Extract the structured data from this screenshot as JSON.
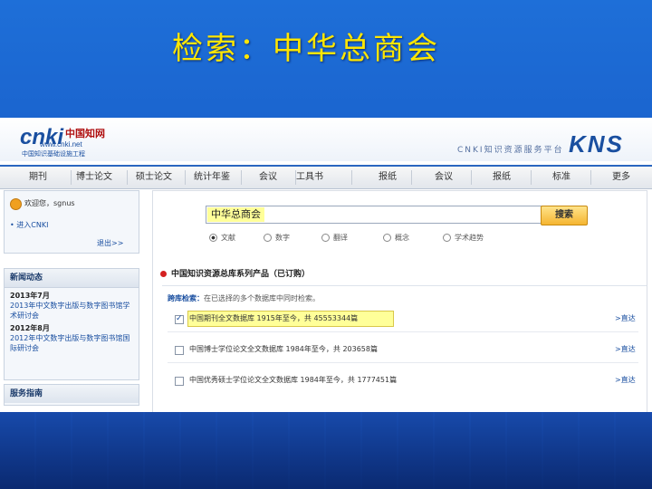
{
  "slide": {
    "title": "检索：中华总商会"
  },
  "header": {
    "logo_main": "cnki",
    "logo_cn": "中国知网",
    "logo_url": "www.cnki.net",
    "logo_sub": "中国知识基础设施工程",
    "tagline": "CNKI知识资源服务平台",
    "product": "KNS"
  },
  "nav": {
    "items": [
      "期刊",
      "博士论文",
      "硕士论文",
      "统计年鉴",
      "会议",
      "工具书",
      "报纸",
      "会议",
      "报纸",
      "标准",
      "更多"
    ]
  },
  "sidebar": {
    "welcome": "欢迎您，sgnus",
    "enter_link": "• 进入CNKI",
    "logout_link": "退出>>",
    "news_title": "新闻动态",
    "news": [
      {
        "date": "2013年7月",
        "desc": "2013年中文数字出版与数字图书馆学术研讨会"
      },
      {
        "date": "2012年8月",
        "desc": "2012年中文数字出版与数字图书馆国际研讨会"
      }
    ],
    "service_title": "服务指南"
  },
  "search": {
    "query": "中华总商会",
    "button": "搜索",
    "options": [
      {
        "label": "文献",
        "selected": true
      },
      {
        "label": "数字",
        "selected": false
      },
      {
        "label": "翻译",
        "selected": false
      },
      {
        "label": "概念",
        "selected": false
      },
      {
        "label": "学术趋势",
        "selected": false
      }
    ]
  },
  "results": {
    "section_title": "中国知识资源总库系列产品（已订购）",
    "path_label": "跨库检索：",
    "path_text": "在已选择的多个数据库中同时检索。",
    "rows": [
      {
        "text": "中国期刊全文数据库  1915年至今，共 45553344篇",
        "link": ">直达",
        "checked": true,
        "highlight": true
      },
      {
        "text": "中国博士学位论文全文数据库  1984年至今，共 203658篇",
        "link": ">直达",
        "checked": false,
        "highlight": false
      },
      {
        "text": "中国优秀硕士学位论文全文数据库  1984年至今，共 1777451篇",
        "link": ">直达",
        "checked": false,
        "highlight": false
      }
    ]
  },
  "colors": {
    "slide_bg": "#1a5cc8",
    "title": "#ffe600",
    "accent": "#1a4fa0",
    "highlight": "#ffff99",
    "button": "#f5b531"
  }
}
